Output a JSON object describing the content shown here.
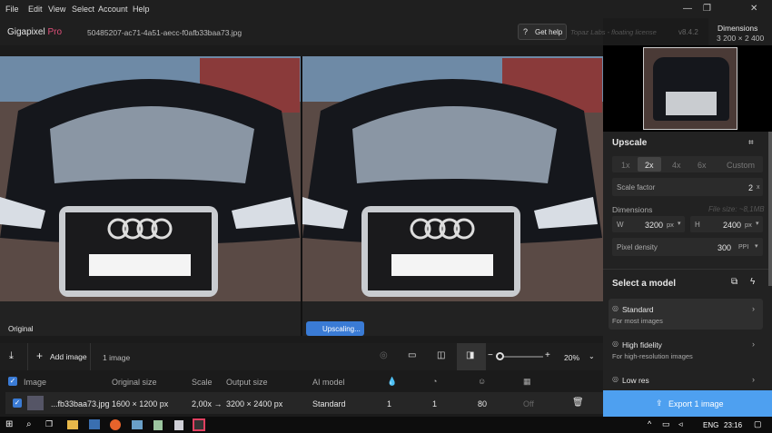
{
  "menu": [
    "File",
    "Edit",
    "View",
    "Select",
    "Account",
    "Help"
  ],
  "app": {
    "name": "Gigapixel",
    "edition": "Pro",
    "filename": "50485207-ac71-4a51-aecc-f0afb33baa73.jpg",
    "help": "Get help",
    "license": "Topaz Labs - floating license",
    "version": "v8.4.2"
  },
  "dims_box": {
    "title": "Dimensions",
    "value": "3 200 × 2 400"
  },
  "viewer": {
    "left_label": "Original",
    "right_label": "Upscaling..."
  },
  "controls": {
    "add_image": "Add image",
    "count": "1 image",
    "zoom": "20%"
  },
  "table": {
    "headers": [
      "Image",
      "Original size",
      "Scale",
      "Output size",
      "AI model"
    ],
    "row": {
      "name": "...fb33baa73.jpg",
      "orig": "1600 × 1200 px",
      "scale": "2,00x →",
      "out": "3200 × 2400 px",
      "model": "Standard",
      "v1": "1",
      "v2": "1",
      "v3": "80",
      "v4": "Off"
    }
  },
  "upscale": {
    "title": "Upscale",
    "scales": [
      "1x",
      "2x",
      "4x",
      "6x",
      "Custom"
    ],
    "active": "2x",
    "scale_factor_label": "Scale factor",
    "scale_factor": "2",
    "scale_unit": "x",
    "dimensions_label": "Dimensions",
    "file_size": "File size: ~8,1MB",
    "w_label": "W",
    "w": "3200",
    "w_unit": "px",
    "h_label": "H",
    "h": "2400",
    "h_unit": "px",
    "density_label": "Pixel density",
    "density": "300",
    "density_unit": "PPI"
  },
  "models": {
    "title": "Select a model",
    "items": [
      {
        "name": "Standard",
        "desc": "For most images"
      },
      {
        "name": "High fidelity",
        "desc": "For high-resolution images"
      },
      {
        "name": "Low res",
        "desc": ""
      }
    ]
  },
  "export": "Export 1 image",
  "taskbar": {
    "lang": "ENG",
    "time": "23:16"
  }
}
